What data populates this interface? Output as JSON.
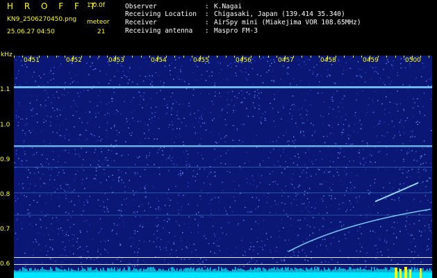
{
  "header": {
    "app_title": "H R O F F T",
    "version": "1.0.0f",
    "filename": "KN9_2506270450.png",
    "mode": "meteor",
    "datetime": "25.06.27 04:50",
    "counter": "21"
  },
  "info": [
    {
      "label": "Observer",
      "value": "K.Nagai"
    },
    {
      "label": "Receiving Location",
      "value": "Chigasaki, Japan (139.414 35.340)"
    },
    {
      "label": "Receiver",
      "value": "AirSpy mini (Miakejima VOR 108.65MHz)"
    },
    {
      "label": "Receiving antenna",
      "value": "Maspro FM-3"
    }
  ],
  "separator": ":",
  "spectrogram": {
    "y_unit": "kHz",
    "y_ticks": [
      "1.1",
      "1.0",
      "0.9",
      "0.8",
      "0.7",
      "0.6"
    ],
    "x_ticks": [
      "0451",
      "0452",
      "0453",
      "0454",
      "0455",
      "0456",
      "0457",
      "0458",
      "0459",
      "0500"
    ],
    "background_color": "#0b1775",
    "trace_color": "#7fd8ff",
    "bottom_color": "#00e5ff",
    "peak_color": "#ffff00"
  }
}
